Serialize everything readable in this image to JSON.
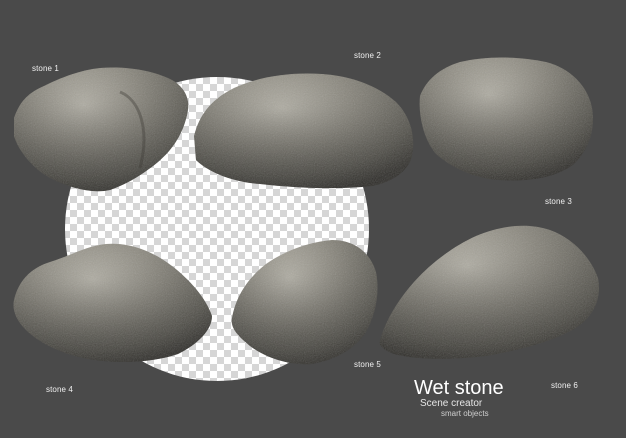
{
  "title": "Wet stone",
  "subtitle": "Scene creator",
  "caption": "smart objects",
  "stones": [
    {
      "label": "stone 1"
    },
    {
      "label": "stone 2"
    },
    {
      "label": "stone 3"
    },
    {
      "label": "stone 4"
    },
    {
      "label": "stone 5"
    },
    {
      "label": "stone 6"
    }
  ],
  "colors": {
    "background": "#4a4a4a",
    "checker_light": "#ffffff",
    "checker_dark": "#d6d6d6",
    "stone_base": "#8c8a80",
    "stone_shadow": "#4e4c46",
    "stone_highlight": "#bdbab0"
  }
}
